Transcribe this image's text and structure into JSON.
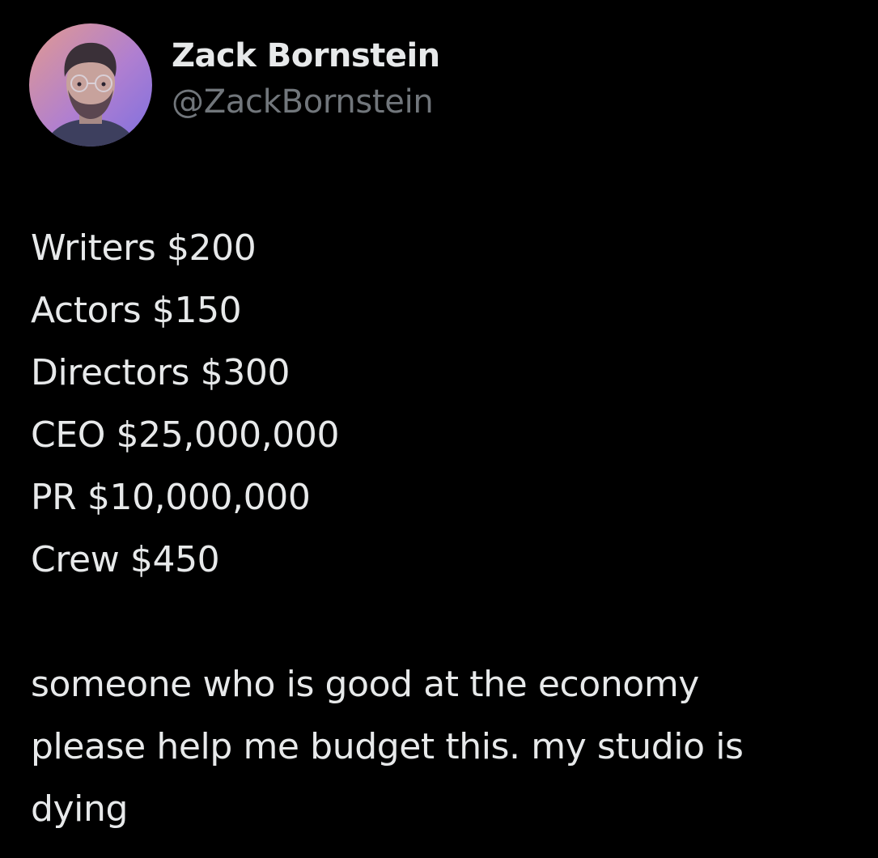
{
  "author": {
    "display_name": "Zack Bornstein",
    "handle": "@ZackBornstein",
    "avatar_icon": "profile-photo"
  },
  "tweet": {
    "lines": [
      "Writers $200",
      "Actors $150",
      "Directors $300",
      "CEO $25,000,000",
      "PR $10,000,000",
      "Crew $450"
    ],
    "closing_lines": [
      "someone who is good at the economy",
      "please help me budget this. my studio is",
      "dying"
    ]
  },
  "colors": {
    "background": "#000000",
    "primary_text": "#e7e9ea",
    "secondary_text": "#71767b"
  }
}
